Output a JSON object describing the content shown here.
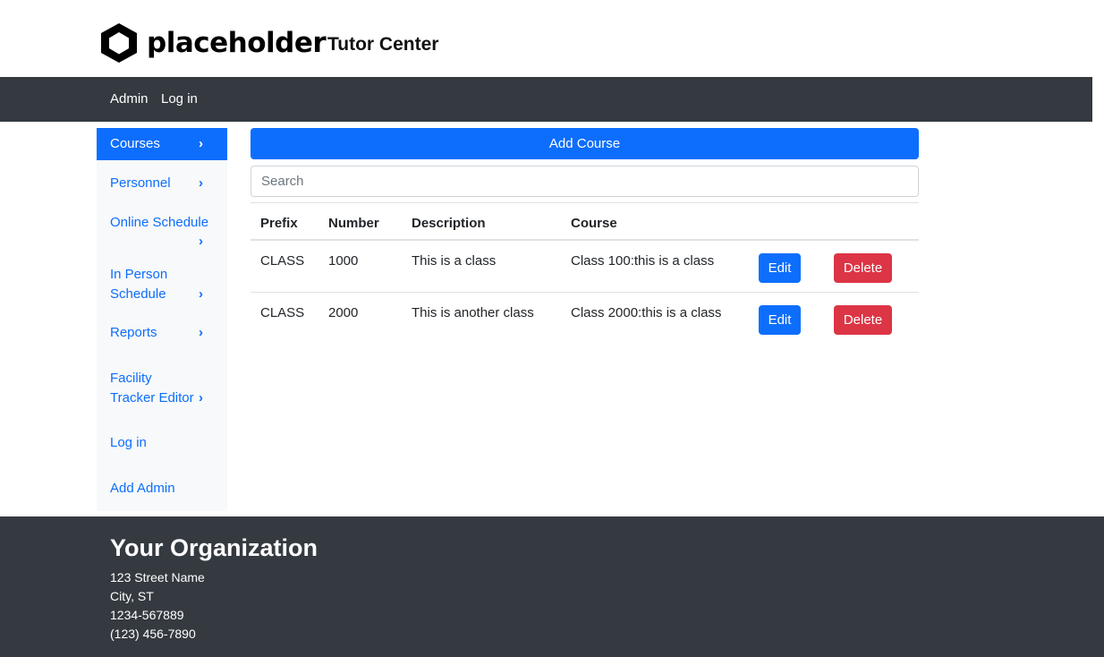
{
  "header": {
    "logo_text": "placeholder",
    "site_title": "Tutor Center"
  },
  "navbar": {
    "items": [
      {
        "label": "Admin"
      },
      {
        "label": "Log in"
      }
    ]
  },
  "sidebar": {
    "items": [
      {
        "label": "Courses",
        "active": true
      },
      {
        "label": "Personnel"
      },
      {
        "label": "Online Schedule"
      },
      {
        "label": "In Person Schedule"
      },
      {
        "label": "Reports"
      },
      {
        "label": "Facility Tracker Editor"
      },
      {
        "label": "Log in"
      },
      {
        "label": "Add Admin"
      }
    ]
  },
  "main": {
    "add_button_label": "Add Course",
    "search": {
      "placeholder": "Search",
      "value": ""
    },
    "table": {
      "headers": [
        "Prefix",
        "Number",
        "Description",
        "Course"
      ],
      "rows": [
        {
          "prefix": "CLASS",
          "number": "1000",
          "description": "This is a class",
          "course": "Class 100:this is a class",
          "edit_label": "Edit",
          "delete_label": "Delete"
        },
        {
          "prefix": "CLASS",
          "number": "2000",
          "description": "This is another class",
          "course": "Class 2000:this is a class",
          "edit_label": "Edit",
          "delete_label": "Delete"
        }
      ]
    }
  },
  "footer": {
    "org_name": "Your Organization",
    "address_lines": [
      "123 Street Name",
      "City, ST",
      "1234-567889",
      "(123) 456-7890"
    ]
  },
  "colors": {
    "primary": "#0d6efd",
    "danger": "#dc3545",
    "dark": "#343a40",
    "sidebar_bg": "#f8f9fa"
  }
}
